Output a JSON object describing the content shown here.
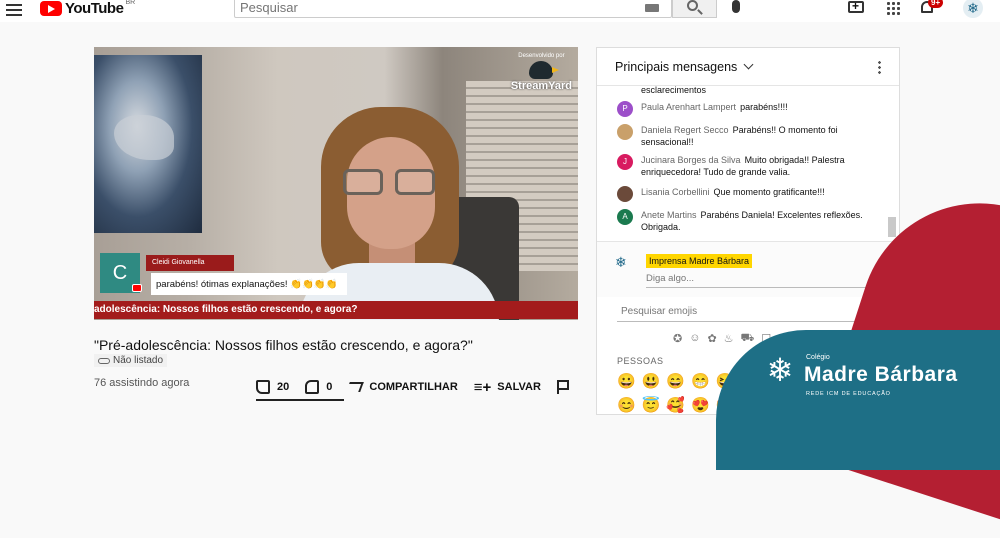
{
  "header": {
    "logo_text": "YouTube",
    "region": "BR",
    "search_placeholder": "Pesquisar",
    "notification_count": "9+"
  },
  "video": {
    "overlay_brand_small": "Desenvolvido por",
    "overlay_brand": "StreamYard",
    "lower_third_initial": "C",
    "lower_third_name": "Cleidi Giovanella",
    "chat_highlight": "parabéns! ótimas explanações! 👏👏👏👏",
    "ticker": "adolescência: Nossos filhos estão crescendo, e agora?"
  },
  "meta": {
    "title": "\"Pré-adolescência: Nossos filhos estão crescendo, e agora?\"",
    "visibility": "Não listado",
    "viewers": "76 assistindo agora",
    "likes": "20",
    "dislikes": "0",
    "share_label": "COMPARTILHAR",
    "save_label": "SALVAR"
  },
  "chat": {
    "header": "Principais mensagens",
    "messages": [
      {
        "initial": "",
        "author": "",
        "text": "esclarecimentos",
        "color": "#ffffff"
      },
      {
        "initial": "P",
        "author": "Paula Arenhart Lampert",
        "text": "parabéns!!!!",
        "color": "#9c4fc9"
      },
      {
        "initial": "",
        "author": "Daniela Regert Secco",
        "text": "Parabéns!! O momento foi sensacional!!",
        "color": "#c9a06a"
      },
      {
        "initial": "J",
        "author": "Jucinara Borges da Silva",
        "text": "Muito obrigada!! Palestra enriquecedora! Tudo de grande valia.",
        "color": "#d81b60"
      },
      {
        "initial": "",
        "author": "Lisania Corbellini",
        "text": "Que momento gratificante!!!",
        "color": "#6b4a3a"
      },
      {
        "initial": "A",
        "author": "Anete Martins",
        "text": "Parabéns Daniela! Excelentes reflexões. Obrigada.",
        "color": "#1b7a4f"
      }
    ],
    "input_author": "Imprensa Madre Bárbara",
    "input_placeholder": "Diga algo...",
    "emoji_search": "Pesquisar emojis",
    "emoji_section": "PESSOAS",
    "emoji_row1": "😀😃😄😁😆",
    "emoji_row2": "😊😇🥰😍🤩"
  },
  "watermark": {
    "small": "Colégio",
    "name": "Madre Bárbara",
    "sub": "REDE ICM DE EDUCAÇÃO"
  }
}
